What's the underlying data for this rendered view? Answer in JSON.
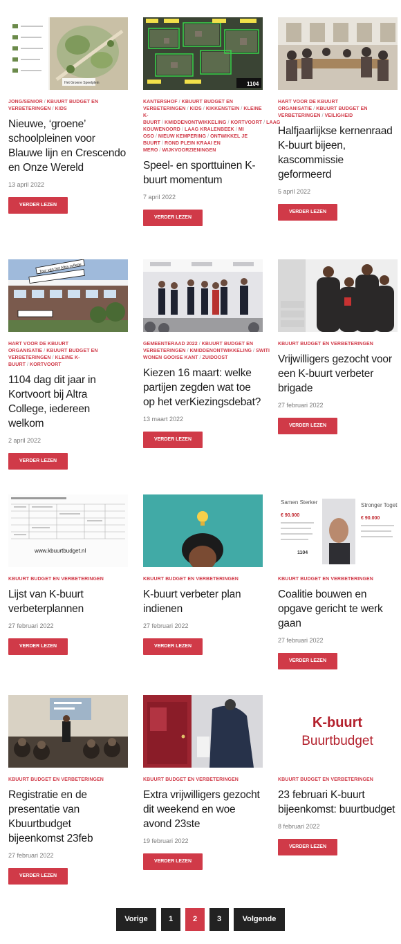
{
  "colors": {
    "accent": "#d03a48",
    "button_dark": "#222222",
    "text": "#1a1a1a",
    "muted": "#7a7a7a"
  },
  "read_more": "VERDER LEZEN",
  "posts": [
    {
      "categories": [
        "JONG/SENIOR",
        "KBUURT BUDGET EN VERBETERINGEN",
        "KIDS"
      ],
      "title": "Nieuwe, ‘groene’ schoolpleinen voor Blauwe lijn en Crescendo en Onze Wereld",
      "date": "13 april 2022",
      "thumb_text": "Het Groene Speelplein"
    },
    {
      "categories": [
        "KANTERSHOF",
        "KBUURT BUDGET EN VERBETERINGEN",
        "KIDS",
        "KIKKENSTEIN",
        "KLEINE K-BUURT",
        "KMIDDENONTWIKKELING",
        "KORTVOORT",
        "LAAG KOUWENOORD",
        "LAAG KRALENBEEK",
        "MI OSO",
        "NIEUW KEMPERING",
        "ONTWIKKEL JE BUURT",
        "ROND PLEIN KRAAI EN MERO",
        "WIJKVOORZIENINGEN"
      ],
      "title": "Speel- en sporttuinen K-buurt momentum",
      "date": "7 april 2022",
      "thumb_text": "1104"
    },
    {
      "categories": [
        "HART VOOR DE KBUURT ORGANISATIE",
        "KBUURT BUDGET EN VERBETERINGEN",
        "VEILIGHEID"
      ],
      "title": "Halfjaarlijkse kernenraad K-buurt bijeen, kascommissie geformeerd",
      "date": "5 april 2022",
      "thumb_text": ""
    },
    {
      "categories": [
        "HART VOOR DE KBUURT ORGANISATIE",
        "KBUURT BUDGET EN VERBETERINGEN",
        "KLEINE K-BUURT",
        "KORTVOORT"
      ],
      "title": "1104 dag dit jaar in Kortvoort bij Altra College, iedereen welkom",
      "date": "2 april 2022",
      "thumb_text": "Tour van het Altra college"
    },
    {
      "categories": [
        "GEMEENTERAAD 2022",
        "KBUURT BUDGET EN VERBETERINGEN",
        "KMIDDENONTWIKKELING",
        "SWITI WONEN GOOISE KANT",
        "ZUIDOOST"
      ],
      "title": "Kiezen 16 maart: welke partijen zegden wat toe op het verKiezingsdebat?",
      "date": "13 maart 2022",
      "thumb_text": ""
    },
    {
      "categories": [
        "KBUURT BUDGET EN VERBETERINGEN"
      ],
      "title": "Vrijwilligers gezocht voor een K-buurt verbeter brigade",
      "date": "27 februari 2022",
      "thumb_text": ""
    },
    {
      "categories": [
        "KBUURT BUDGET EN VERBETERINGEN"
      ],
      "title": "Lijst van K-buurt verbeterplannen",
      "date": "27 februari 2022",
      "thumb_text": "www.kbuurtbudget.nl"
    },
    {
      "categories": [
        "KBUURT BUDGET EN VERBETERINGEN"
      ],
      "title": "K-buurt verbeter plan indienen",
      "date": "27 februari 2022",
      "thumb_text": ""
    },
    {
      "categories": [
        "KBUURT BUDGET EN VERBETERINGEN"
      ],
      "title": "Coalitie bouwen en opgave gericht te werk gaan",
      "date": "27 februari 2022",
      "thumb_text_left": "Samen Sterker",
      "thumb_amount_left": "€ 90.000",
      "thumb_text_right": "Stronger Together",
      "thumb_amount_right": "€ 90.000",
      "thumb_code": "1104"
    },
    {
      "categories": [
        "KBUURT BUDGET EN VERBETERINGEN"
      ],
      "title": "Registratie en de presentatie van Kbuurtbudget bijeenkomst 23feb",
      "date": "27 februari 2022",
      "thumb_text": ""
    },
    {
      "categories": [
        "KBUURT BUDGET EN VERBETERINGEN"
      ],
      "title": "Extra vrijwilligers gezocht dit weekend en woe avond 23ste",
      "date": "19 februari 2022",
      "thumb_text": ""
    },
    {
      "categories": [
        "KBUURT BUDGET EN VERBETERINGEN"
      ],
      "title": "23 februari K-buurt bijeenkomst: buurtbudget",
      "date": "8 februari 2022",
      "thumb_line1": "K-buurt",
      "thumb_line2": "Buurtbudget"
    }
  ],
  "pagination": {
    "prev": "Vorige",
    "pages": [
      "1",
      "2",
      "3"
    ],
    "current": "2",
    "next": "Volgende"
  }
}
